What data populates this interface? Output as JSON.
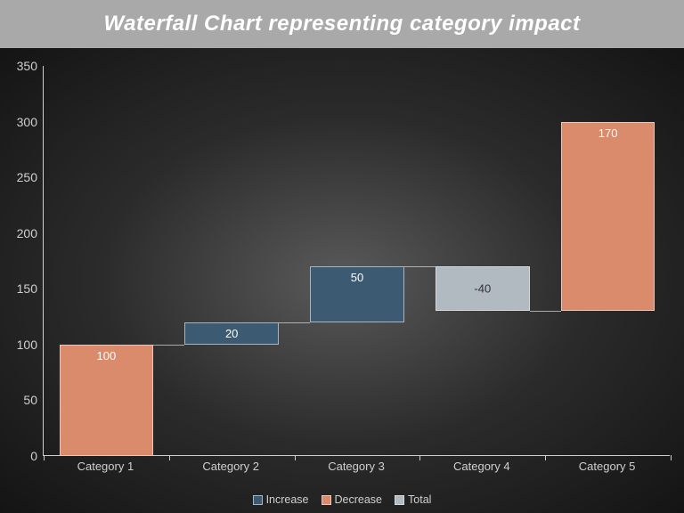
{
  "header": {
    "title": "Waterfall Chart representing category impact"
  },
  "chart_data": {
    "type": "bar",
    "subtype": "waterfall",
    "title": "Waterfall Chart representing category impact",
    "xlabel": "",
    "ylabel": "",
    "categories": [
      "Category 1",
      "Category 2",
      "Category 3",
      "Category 4",
      "Category 5"
    ],
    "values": [
      100,
      20,
      50,
      -40,
      170
    ],
    "kinds": [
      "start",
      "increase",
      "increase",
      "decrease",
      "total"
    ],
    "data_labels": [
      "100",
      "20",
      "50",
      "-40",
      "170"
    ],
    "y_ticks": [
      0,
      50,
      100,
      150,
      200,
      250,
      300,
      350
    ],
    "ylim": [
      0,
      350
    ],
    "legend": [
      "Increase",
      "Decrease",
      "Total"
    ],
    "colors": {
      "increase": "#3d5a73",
      "decrease": "#d98b6b",
      "total": "#b1b9c1",
      "start": "#d98b6b"
    }
  }
}
